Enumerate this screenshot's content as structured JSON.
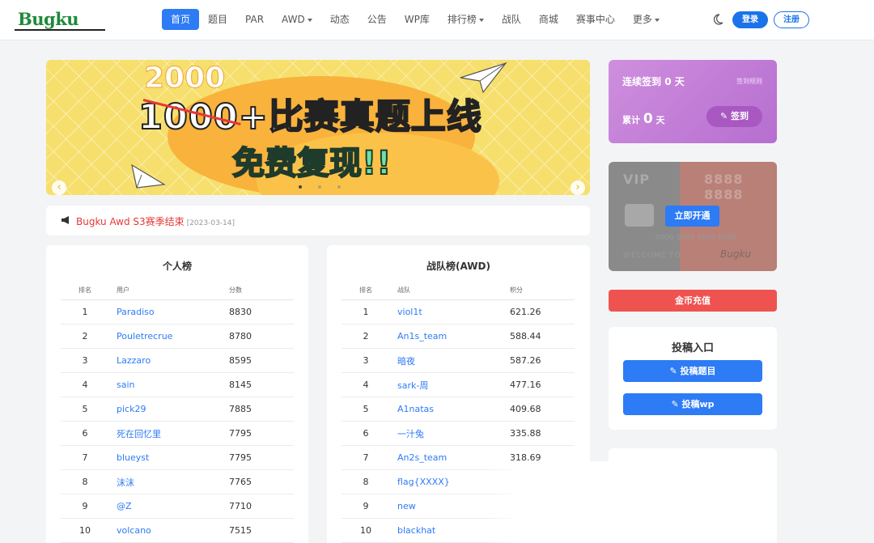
{
  "logo": {
    "text": "Bugku",
    "dots": "..."
  },
  "nav": {
    "items": [
      {
        "label": "首页",
        "active": true,
        "dropdown": false
      },
      {
        "label": "题目",
        "active": false,
        "dropdown": false
      },
      {
        "label": "PAR",
        "active": false,
        "dropdown": false
      },
      {
        "label": "AWD",
        "active": false,
        "dropdown": true
      },
      {
        "label": "动态",
        "active": false,
        "dropdown": false
      },
      {
        "label": "公告",
        "active": false,
        "dropdown": false
      },
      {
        "label": "WP库",
        "active": false,
        "dropdown": false
      },
      {
        "label": "排行榜",
        "active": false,
        "dropdown": true
      },
      {
        "label": "战队",
        "active": false,
        "dropdown": false
      },
      {
        "label": "商城",
        "active": false,
        "dropdown": false
      },
      {
        "label": "赛事中心",
        "active": false,
        "dropdown": false
      },
      {
        "label": "更多",
        "active": false,
        "dropdown": true
      }
    ],
    "login": "登录",
    "register": "注册"
  },
  "banner": {
    "number_new": "2000",
    "number_old": "1000",
    "headline_rest": "+比赛真题上线",
    "subline": "免费复现!!",
    "prev": "‹",
    "next": "›"
  },
  "notice": {
    "text": "Bugku Awd S3赛季结束",
    "date": "[2023-03-14]"
  },
  "personal": {
    "title": "个人榜",
    "headers": [
      "排名",
      "用户",
      "分数"
    ],
    "rows": [
      [
        "1",
        "Paradiso",
        "8830"
      ],
      [
        "2",
        "Pouletrecrue",
        "8780"
      ],
      [
        "3",
        "Lazzaro",
        "8595"
      ],
      [
        "4",
        "sain",
        "8145"
      ],
      [
        "5",
        "pick29",
        "7885"
      ],
      [
        "6",
        "死在回忆里",
        "7795"
      ],
      [
        "7",
        "blueyst",
        "7795"
      ],
      [
        "8",
        "沫沫",
        "7765"
      ],
      [
        "9",
        "@Z",
        "7710"
      ],
      [
        "10",
        "volcano",
        "7515"
      ]
    ]
  },
  "team": {
    "title": "战队榜(AWD)",
    "headers": [
      "排名",
      "战队",
      "积分"
    ],
    "rows": [
      [
        "1",
        "viol1t",
        "621.26"
      ],
      [
        "2",
        "An1s_team",
        "588.44"
      ],
      [
        "3",
        "暗夜",
        "587.26"
      ],
      [
        "4",
        "sark-周",
        "477.16"
      ],
      [
        "5",
        "A1natas",
        "409.68"
      ],
      [
        "6",
        "一汁兔",
        "335.88"
      ],
      [
        "7",
        "An2s_team",
        "318.69"
      ],
      [
        "8",
        "flag{XXXX}",
        ""
      ],
      [
        "9",
        "new",
        ""
      ],
      [
        "10",
        "blackhat",
        ""
      ]
    ]
  },
  "sign": {
    "streak_prefix": "连续签到",
    "streak_value": "0",
    "streak_unit": "天",
    "rules": "签到规则",
    "total_prefix": "累计",
    "total_value": "0",
    "total_unit": "天",
    "button": "签到"
  },
  "vip": {
    "title": "VIP",
    "number": "8888 8888",
    "card_no": "0000 0000 0000 0000",
    "holder": "WELCOME TO",
    "signature": "Bugku",
    "button": "立即开通"
  },
  "coin": {
    "button": "金币充值"
  },
  "contrib": {
    "title": "投稿入口",
    "btn1": "投稿题目",
    "btn2": "投稿wp"
  }
}
